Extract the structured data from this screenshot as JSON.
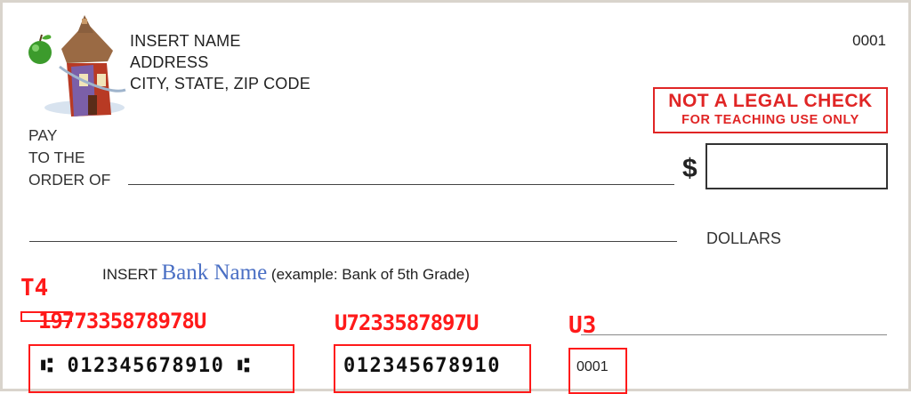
{
  "payer": {
    "name": "INSERT NAME",
    "address": "ADDRESS",
    "city_state_zip": "CITY, STATE, ZIP CODE"
  },
  "check_number": "0001",
  "stamp": {
    "line1": "NOT A LEGAL CHECK",
    "line2": "FOR TEACHING USE ONLY"
  },
  "pay_to": {
    "line1": "PAY",
    "line2": "TO THE",
    "line3": "ORDER OF"
  },
  "dollar_sign": "$",
  "dollars_label": "DOLLARS",
  "bank": {
    "prefix": "INSERT",
    "name": "Bank Name",
    "suffix": "(example: Bank of 5th Grade)"
  },
  "annotations": {
    "t4": "T4",
    "long1": "1977335878978U",
    "long2": "U7233587897U",
    "u3": "U3"
  },
  "micr": {
    "routing": "012345678910",
    "account": "012345678910",
    "check": "0001",
    "symbol_left": "⑆",
    "symbol_right": "⑆"
  },
  "colors": {
    "stamp_red": "#e02525",
    "annotation_red": "#ff1a1a",
    "bank_name_blue": "#4a6fc4"
  }
}
